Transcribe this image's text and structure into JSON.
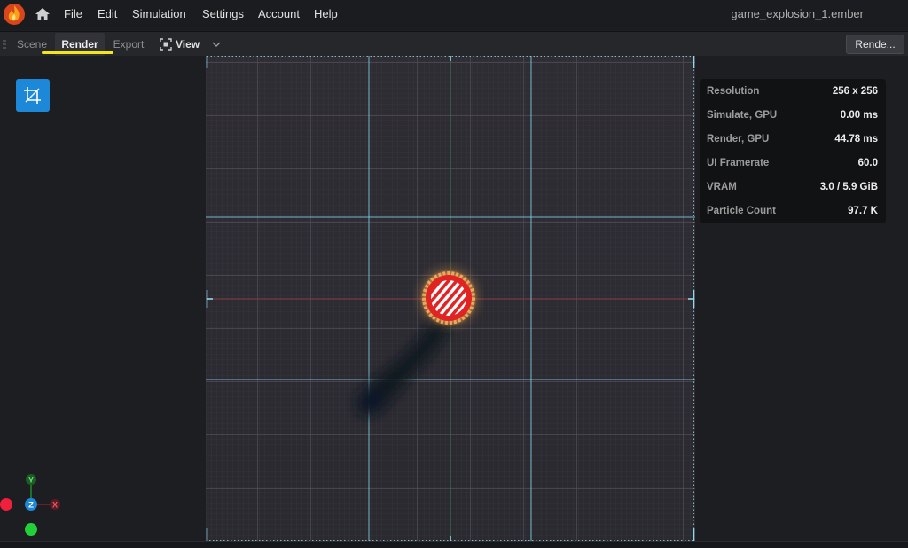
{
  "menubar": {
    "items": [
      "File",
      "Edit",
      "Simulation",
      "Settings",
      "Account",
      "Help"
    ],
    "doc_title": "game_explosion_1.ember",
    "logo_icon": "flame-logo-icon",
    "home_icon": "home-icon"
  },
  "tabs": {
    "scene": "Scene",
    "render": "Render",
    "export": "Export",
    "view_label": "View",
    "view_icon": "focus-frame-icon",
    "active": "Render"
  },
  "toolbar": {
    "render_button": "Rende..."
  },
  "left_tools": {
    "crop_icon": "crop-icon"
  },
  "gizmo": {
    "y": "Y",
    "z": "Z",
    "x": "X"
  },
  "stats": [
    {
      "label": "Resolution",
      "value": "256 x 256"
    },
    {
      "label": "Simulate, GPU",
      "value": "0.00 ms"
    },
    {
      "label": "Render, GPU",
      "value": "44.78 ms"
    },
    {
      "label": "UI Framerate",
      "value": "60.0"
    },
    {
      "label": "VRAM",
      "value": "3.0 / 5.9 GiB"
    },
    {
      "label": "Particle Count",
      "value": "97.7 K"
    }
  ],
  "colors": {
    "accent": "#1e88d8",
    "annotation": "#f5e61b",
    "explosion_red": "#e02424",
    "guide_cyan": "#7fd1e6"
  }
}
